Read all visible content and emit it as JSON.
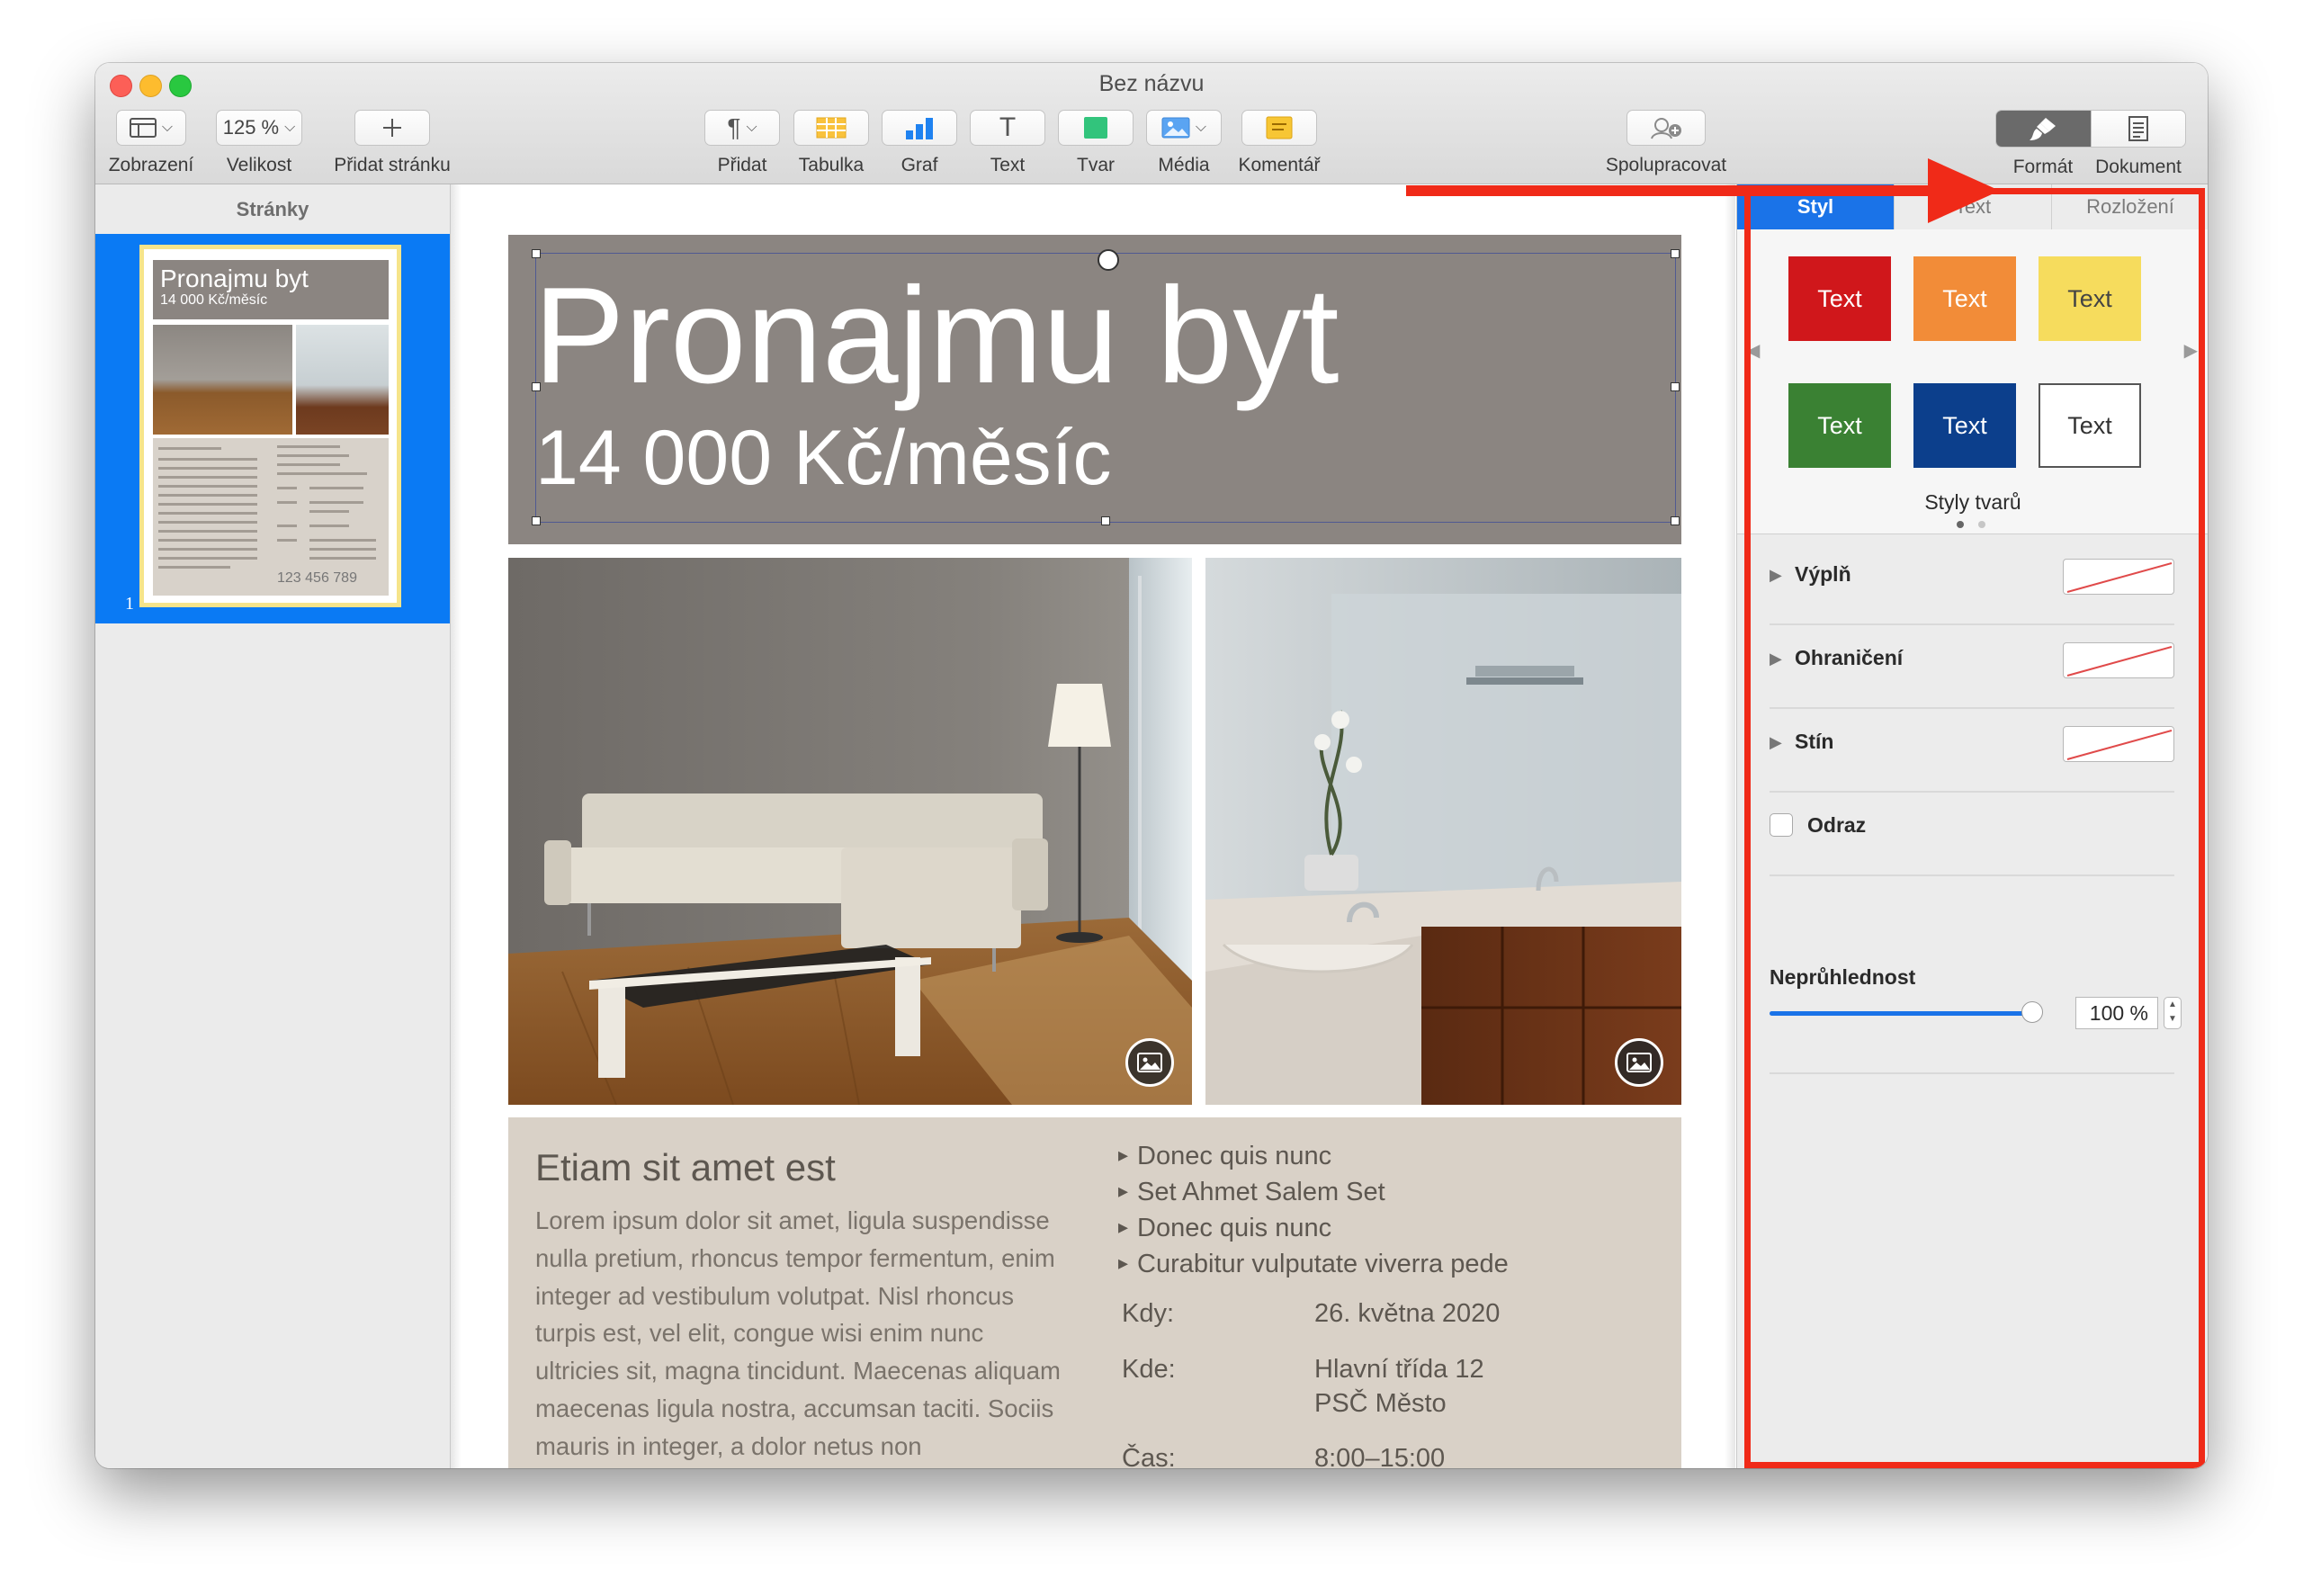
{
  "window": {
    "title": "Bez názvu"
  },
  "toolbar": {
    "view": {
      "label": "Zobrazení",
      "icon": "sidebar-view-icon"
    },
    "zoom": {
      "label": "Velikost",
      "value": "125 %"
    },
    "add_page": {
      "label": "Přidat stránku",
      "icon": "plus-icon"
    },
    "insert": {
      "label": "Přidat",
      "icon": "paragraph-icon"
    },
    "table": {
      "label": "Tabulka",
      "icon": "table-icon"
    },
    "chart": {
      "label": "Graf",
      "icon": "bar-chart-icon"
    },
    "text": {
      "label": "Text",
      "icon": "text-icon",
      "glyph": "T"
    },
    "shape": {
      "label": "Tvar",
      "icon": "shape-icon"
    },
    "media": {
      "label": "Média",
      "icon": "image-icon"
    },
    "comment": {
      "label": "Komentář",
      "icon": "comment-icon"
    },
    "collaborate": {
      "label": "Spolupracovat",
      "icon": "collaborate-icon"
    },
    "format": {
      "label": "Formát",
      "icon": "paintbrush-icon"
    },
    "document": {
      "label": "Dokument",
      "icon": "document-icon"
    }
  },
  "sidebar": {
    "header": "Stránky",
    "pages": [
      {
        "number": "1",
        "title": "Pronajmu byt",
        "subtitle": "14 000 Kč/měsíc",
        "phone": "123 456 789"
      }
    ]
  },
  "document": {
    "title": "Pronajmu byt",
    "subtitle": "14 000 Kč/měsíc",
    "heading": "Etiam sit amet est",
    "body": "Lorem ipsum dolor sit amet, ligula suspendisse nulla pretium, rhoncus tempor fermentum, enim integer ad vestibulum volutpat. Nisl rhoncus turpis est, vel elit, congue wisi enim nunc ultricies sit, magna tincidunt. Maecenas aliquam maecenas ligula nostra, accumsan taciti. Sociis mauris in integer, a dolor netus non",
    "bullets": [
      "Donec quis nunc",
      "Set Ahmet Salem Set",
      "Donec quis nunc",
      "Curabitur vulputate viverra pede"
    ],
    "when_label": "Kdy:",
    "when_value": "26. května 2020",
    "where_label": "Kde:",
    "where_line1": "Hlavní třída 12",
    "where_line2": "PSČ Město",
    "time_label": "Čas:",
    "time_value": "8:00–15:00"
  },
  "format_panel": {
    "tabs": [
      "Styl",
      "Text",
      "Rozložení"
    ],
    "active_tab": "Styl",
    "styles": [
      {
        "label": "Text",
        "bg": "#d0171b",
        "fg": "#ffffff"
      },
      {
        "label": "Text",
        "bg": "#f28c38",
        "fg": "#ffffff"
      },
      {
        "label": "Text",
        "bg": "#f6dc5d",
        "fg": "#444444"
      },
      {
        "label": "Text",
        "bg": "#3a8133",
        "fg": "#ffffff"
      },
      {
        "label": "Text",
        "bg": "#0c3f8c",
        "fg": "#ffffff"
      },
      {
        "label": "Text",
        "bg": "#ffffff",
        "fg": "#333333"
      }
    ],
    "styles_caption": "Styly tvarů",
    "fill_label": "Výplň",
    "border_label": "Ohraničení",
    "shadow_label": "Stín",
    "reflection_label": "Odraz",
    "opacity_label": "Neprůhlednost",
    "opacity_value": "100 %",
    "opacity_fraction": 1.0
  },
  "colors": {
    "accent": "#1a73e8",
    "annotation_red": "#f02a18",
    "header_gray": "#8b8581",
    "content_beige": "#d9d1c7"
  }
}
